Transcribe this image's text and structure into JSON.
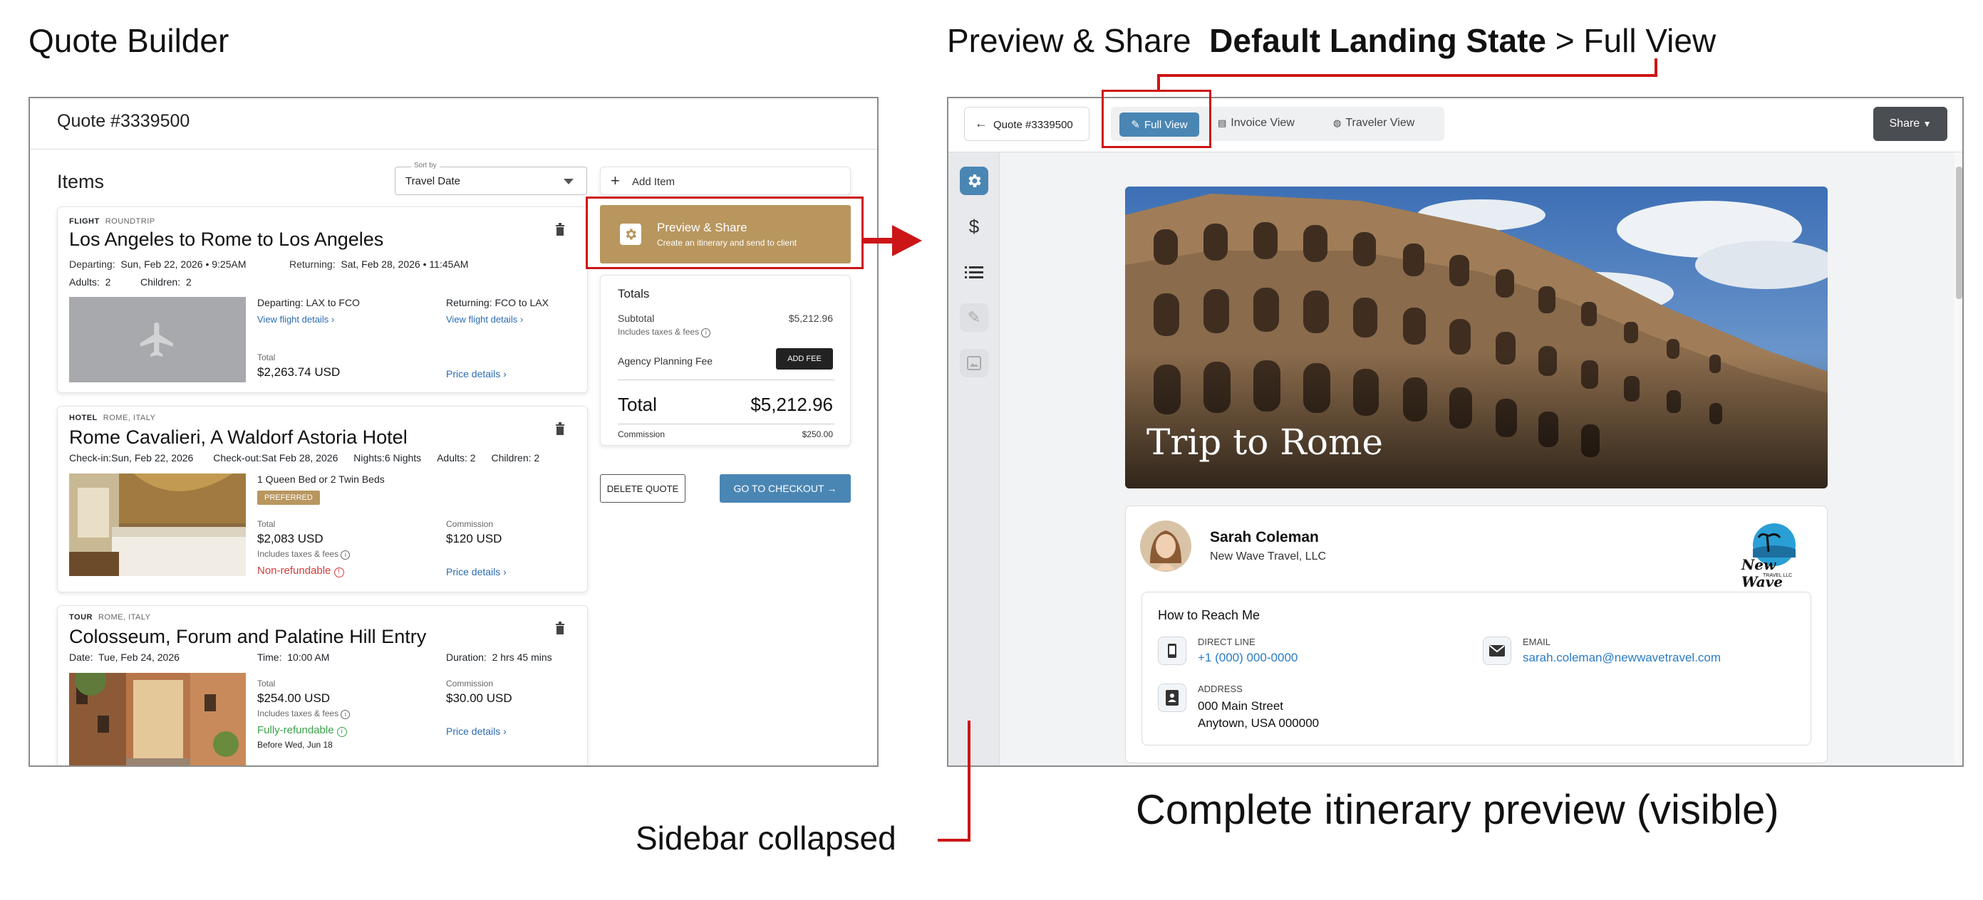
{
  "headings": {
    "quote_builder": "Quote Builder",
    "preview_share": "Preview & Share",
    "landing_state": "Default Landing State",
    "crumb_sep": ">",
    "full_view": "Full View",
    "sidebar_collapsed": "Sidebar collapsed",
    "complete_preview": "Complete itinerary preview (visible)"
  },
  "quote_builder": {
    "quote_title": "Quote #3339500",
    "items_heading": "Items",
    "sort": {
      "label": "Sort by",
      "value": "Travel Date"
    },
    "flight": {
      "type": "FLIGHT",
      "subtype": "ROUNDTRIP",
      "title": "Los Angeles to Rome to Los Angeles",
      "departing_label": "Departing:",
      "departing_value": "Sun, Feb 22, 2026  • 9:25AM",
      "returning_label": "Returning:",
      "returning_value": "Sat, Feb 28, 2026  • 11:45AM",
      "adults_label": "Adults:",
      "adults_value": "2",
      "children_label": "Children:",
      "children_value": "2",
      "dep_route": "Departing: LAX to FCO",
      "ret_route": "Returning: FCO to LAX",
      "view_details": "View flight details",
      "total_label": "Total",
      "total_value": "$2,263.74 USD",
      "price_details": "Price details"
    },
    "hotel": {
      "type": "HOTEL",
      "subtype": "ROME, ITALY",
      "title": "Rome Cavalieri, A Waldorf Astoria Hotel",
      "checkin_label": "Check-in:",
      "checkin_value": "Sun, Feb 22, 2026",
      "checkout_label": "Check-out:",
      "checkout_value": "Sat Feb 28, 2026",
      "nights_label": "Nights:",
      "nights_value": "6 Nights",
      "adults_label": "Adults:",
      "adults_value": "2",
      "children_label": "Children:",
      "children_value": "2",
      "room": "1 Queen Bed or 2 Twin Beds",
      "badge": "PREFERRED",
      "total_label": "Total",
      "total_value": "$2,083 USD",
      "includes": "Includes taxes & fees",
      "commission_label": "Commission",
      "commission_value": "$120 USD",
      "refund": "Non-refundable",
      "price_details": "Price details"
    },
    "tour": {
      "type": "TOUR",
      "subtype": "ROME, ITALY",
      "title": "Colosseum, Forum and Palatine Hill Entry",
      "date_label": "Date:",
      "date_value": "Tue, Feb 24, 2026",
      "time_label": "Time:",
      "time_value": "10:00 AM",
      "duration_label": "Duration:",
      "duration_value": "2 hrs 45 mins",
      "total_label": "Total",
      "total_value": "$254.00 USD",
      "includes": "Includes taxes & fees",
      "commission_label": "Commission",
      "commission_value": "$30.00 USD",
      "refund": "Fully-refundable",
      "refund_before": "Before Wed, Jun 18",
      "price_details": "Price details"
    },
    "add_item": "Add Item",
    "preview_btn": {
      "title": "Preview & Share",
      "subtitle": "Create an itinerary and send to client"
    },
    "totals": {
      "heading": "Totals",
      "subtotal_label": "Subtotal",
      "subtotal_value": "$5,212.96",
      "includes": "Includes taxes & fees",
      "fee_label": "Agency Planning Fee",
      "add_fee": "ADD FEE",
      "total_label": "Total",
      "total_value": "$5,212.96",
      "commission_label": "Commission",
      "commission_value": "$250.00"
    },
    "delete_quote": "DELETE QUOTE",
    "checkout": "GO TO CHECKOUT"
  },
  "preview": {
    "back_label": "Quote #3339500",
    "tabs": [
      "Full View",
      "Invoice View",
      "Traveler View"
    ],
    "share": "Share",
    "hero_title": "Trip to Rome",
    "agent": {
      "name": "Sarah Coleman",
      "company": "New Wave Travel, LLC",
      "logo_text": "New Wave",
      "logo_sub": "TRAVEL LLC"
    },
    "reach": {
      "heading": "How to Reach Me",
      "direct_label": "DIRECT LINE",
      "direct_value": "+1 (000) 000-0000",
      "email_label": "EMAIL",
      "email_value": "sarah.coleman@newwavetravel.com",
      "address_label": "ADDRESS",
      "address_line1": "000 Main Street",
      "address_line2": "Anytown, USA 000000"
    }
  },
  "colors": {
    "accent_gold": "#b8965e",
    "checkout_blue": "#4a86b4",
    "annotation_red": "#cc1517",
    "tab_active": "#4a86b4",
    "sidebar_active": "#4a86b4"
  }
}
